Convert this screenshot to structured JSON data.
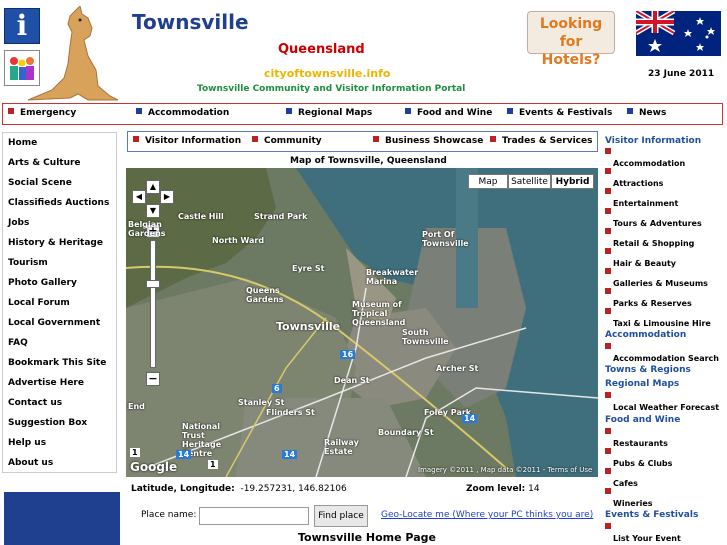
{
  "header": {
    "site_title": "Townsville",
    "region": "Queensland",
    "domain": "cityoftownsville.info",
    "portal_text": "Townsville Community and Visitor Information Portal",
    "hotels_button": [
      "Looking for",
      "Hotels?"
    ],
    "date": "23 June 2011"
  },
  "top_nav": [
    "Emergency",
    "Accommodation",
    "Regional Maps",
    "Food and Wine",
    "Events & Festivals",
    "News"
  ],
  "left_nav": [
    "Home",
    "Arts & Culture",
    "Social Scene",
    "Classifieds Auctions",
    "Jobs",
    "History & Heritage",
    "Tourism",
    "Photo Gallery",
    "Local Forum",
    "Local Government",
    "FAQ",
    "Bookmark This Site",
    "Advertise Here",
    "Contact us",
    "Suggestion Box",
    "Help us",
    "About us"
  ],
  "sub_nav": [
    "Visitor Information",
    "Community",
    "Business Showcase",
    "Trades & Services"
  ],
  "map": {
    "title": "Map of Townsville, Queensland",
    "types": [
      "Map",
      "Satellite",
      "Hybrid"
    ],
    "selected_type": "Hybrid",
    "attribution": "Imagery ©2011 , Map data ©2011 - Terms of Use",
    "google": "Google",
    "labels": [
      "Castle Hill",
      "Strand Park",
      "North Ward",
      "Port Of Townsville",
      "Breakwater Marina",
      "Museum of Tropical Queensland",
      "Townsville",
      "South Townsville",
      "Queens Gardens",
      "Foley Park",
      "National Trust Heritage Centre",
      "Railway Estate",
      "Boundary St",
      "Archer St",
      "Eyre St",
      "Dean St",
      "Stanley St",
      "Flinders St",
      "Belgian Gardens",
      "End"
    ],
    "routes": [
      "16",
      "6",
      "14",
      "14",
      "14",
      "1",
      "1"
    ]
  },
  "coords": {
    "label": "Latitude, Longitude:",
    "value": "-19.257231, 146.82106",
    "zoom_label": "Zoom level:",
    "zoom_value": "14"
  },
  "search": {
    "label": "Place name:",
    "value": "",
    "button": "Find place",
    "geo_link": "Geo-Locate me (Where your PC thinks you are)"
  },
  "home_link": "Townsville Home Page",
  "right_nav": {
    "visitor_heading": "Visitor Information",
    "visitor_items": [
      "Accommodation",
      "Attractions",
      "Entertainment",
      "Tours & Adventures",
      "Retail & Shopping",
      "Hair & Beauty",
      "Galleries & Museums",
      "Parks & Reserves",
      "Taxi & Limousine Hire"
    ],
    "accommodation_heading": "Accommodation",
    "accommodation_items": [
      "Accommodation Search"
    ],
    "towns_heading": "Towns & Regions",
    "maps_heading": "Regional Maps",
    "maps_items": [
      "Local Weather Forecast"
    ],
    "food_heading": "Food and Wine",
    "food_items": [
      "Restaurants",
      "Pubs & Clubs",
      "Cafes",
      "Wineries"
    ],
    "events_heading": "Events & Festivals",
    "events_items": [
      "List Your Event"
    ]
  },
  "colors": {
    "title_blue": "#1f3f8f",
    "region_red": "#cc0000",
    "domain_gold": "#f0b400",
    "portal_green": "#1f8f3f",
    "hotels_orange": "#e07a1f",
    "nav_border": "#cc3333"
  }
}
